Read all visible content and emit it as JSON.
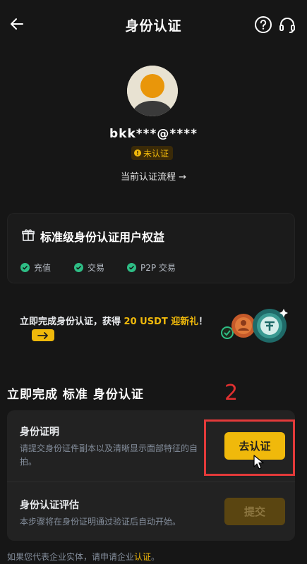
{
  "header": {
    "title": "身份认证",
    "back_icon": "arrow-left-icon",
    "help_icon": "question-circle-icon",
    "support_icon": "headset-icon"
  },
  "profile": {
    "username": "bkk***@****",
    "status_badge": "未认证",
    "flow_link": "当前认证流程 →"
  },
  "benefits": {
    "title": "标准级身份认证用户权益",
    "items": [
      "充值",
      "交易",
      "P2P 交易"
    ]
  },
  "promo": {
    "text_before": "立即完成身份认证，获得 ",
    "highlight": "20 USDT 迎新礼",
    "text_after": "！"
  },
  "verify_section": {
    "title": "立即完成 标准 身份认证",
    "annotation_number": "2",
    "steps": [
      {
        "title": "身份证明",
        "description": "请提交身份证件副本以及清晰显示面部特征的自拍。",
        "button": "去认证"
      },
      {
        "title": "身份认证评估",
        "description": "本步骤将在身份证明通过验证后自动开始。",
        "button": "提交"
      }
    ]
  },
  "footer": {
    "text": "如果您代表企业实体，请申请企业",
    "link": "认证",
    "suffix": "。"
  },
  "colors": {
    "accent": "#f0b90b",
    "background": "#161616",
    "success": "#2ebd85",
    "annotation": "#e33a3a"
  }
}
